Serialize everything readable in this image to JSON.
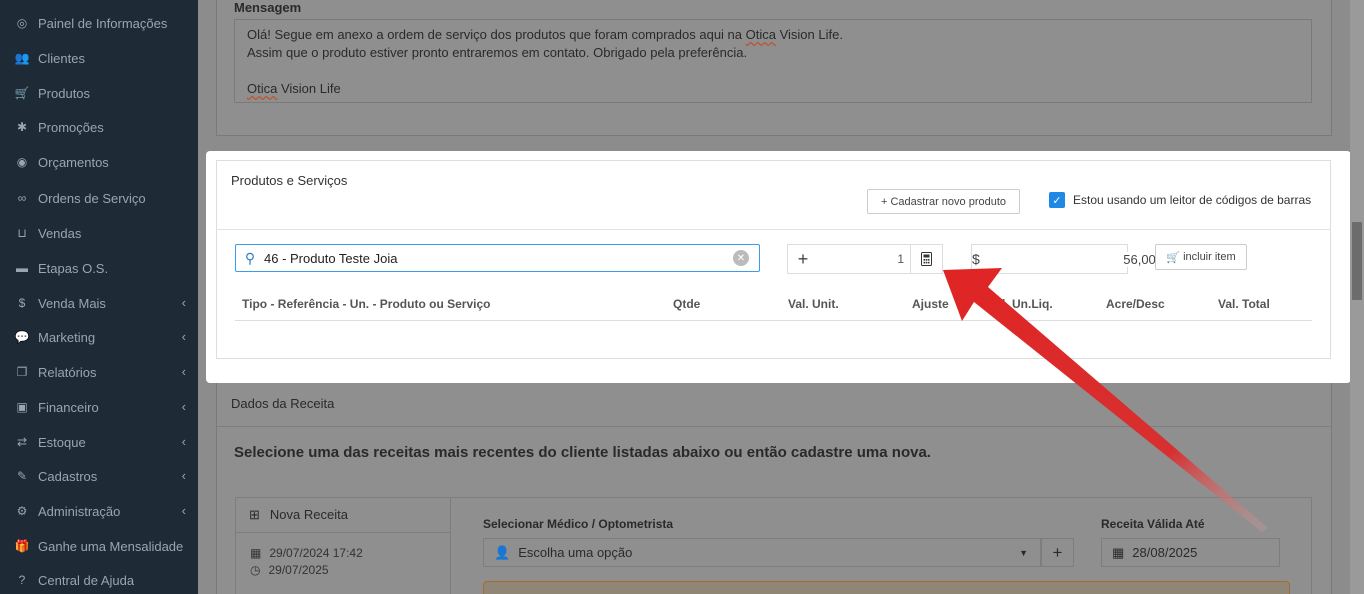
{
  "sidebar": {
    "items": [
      {
        "label": "Painel de Informações",
        "icon": "dashboard-icon",
        "glyph": "◎",
        "chevron": false
      },
      {
        "label": "Clientes",
        "icon": "users-icon",
        "glyph": "👥",
        "chevron": false
      },
      {
        "label": "Produtos",
        "icon": "cart-icon",
        "glyph": "🛒",
        "chevron": false
      },
      {
        "label": "Promoções",
        "icon": "asterisk-icon",
        "glyph": "✱",
        "chevron": false
      },
      {
        "label": "Orçamentos",
        "icon": "coins-icon",
        "glyph": "◉",
        "chevron": false
      },
      {
        "label": "Ordens de Serviço",
        "icon": "glasses-icon",
        "glyph": "∞",
        "chevron": false
      },
      {
        "label": "Vendas",
        "icon": "basket-icon",
        "glyph": "⊔",
        "chevron": false
      },
      {
        "label": "Etapas O.S.",
        "icon": "cash-icon",
        "glyph": "▬",
        "chevron": false
      },
      {
        "label": "Venda Mais",
        "icon": "dollar-icon",
        "glyph": "$",
        "chevron": true
      },
      {
        "label": "Marketing",
        "icon": "comments-icon",
        "glyph": "💬",
        "chevron": true
      },
      {
        "label": "Relatórios",
        "icon": "copy-icon",
        "glyph": "❐",
        "chevron": true
      },
      {
        "label": "Financeiro",
        "icon": "money-icon",
        "glyph": "▣",
        "chevron": true
      },
      {
        "label": "Estoque",
        "icon": "exchange-icon",
        "glyph": "⇄",
        "chevron": true
      },
      {
        "label": "Cadastros",
        "icon": "edit-icon",
        "glyph": "✎",
        "chevron": true
      },
      {
        "label": "Administração",
        "icon": "cogs-icon",
        "glyph": "⚙",
        "chevron": true
      },
      {
        "label": "Ganhe uma Mensalidade",
        "icon": "gift-icon",
        "glyph": "🎁",
        "chevron": false
      },
      {
        "label": "Central de Ajuda",
        "icon": "help-icon",
        "glyph": "?",
        "chevron": false
      }
    ]
  },
  "message": {
    "label": "Mensagem",
    "line1_a": "Olá! Segue em anexo a ordem de serviço dos produtos que foram comprados aqui na ",
    "line1_b": "Otica",
    "line1_c": " Vision Life.",
    "line2": "Assim que o produto estiver pronto entraremos em contato. Obrigado pela preferência.",
    "line4_a": "Otica",
    "line4_b": " Vision Life"
  },
  "products": {
    "title": "Produtos e Serviços",
    "new_product_button": "+ Cadastrar novo produto",
    "barcode_label": "Estou usando um leitor de códigos de barras",
    "barcode_checked": true,
    "search_value": "46 - Produto Teste Joia",
    "quantity": "1",
    "currency": "$",
    "price": "56,00",
    "include_button": "incluir item",
    "columns": [
      "Tipo - Referência - Un. - Produto ou Serviço",
      "Qtde",
      "Val. Unit.",
      "Ajuste",
      "Val. Un.Liq.",
      "Acre/Desc",
      "Val. Total"
    ]
  },
  "receita": {
    "title": "Dados da Receita",
    "subtitle": "Selecione uma das receitas mais recentes do cliente listadas abaixo ou então cadastre uma nova.",
    "nova_receita": "Nova Receita",
    "date_created": "29/07/2024 17:42",
    "date_valid": "29/07/2025",
    "doctor_label": "Selecionar Médico / Optometrista",
    "doctor_placeholder": "Escolha uma opção",
    "valid_until_label": "Receita Válida Até",
    "valid_until_value": "28/08/2025"
  },
  "colors": {
    "sidebar_bg": "#1e2a35",
    "accent": "#1e88e5",
    "arrow": "#e02424"
  }
}
